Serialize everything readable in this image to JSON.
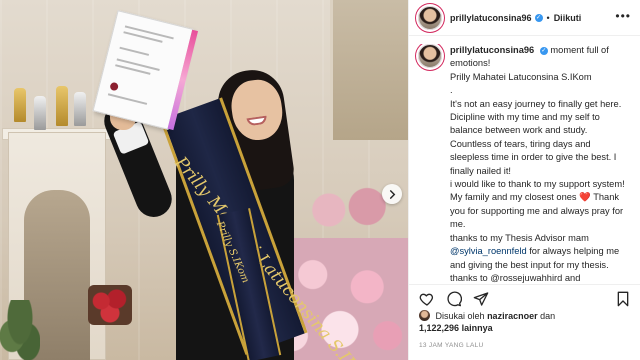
{
  "photo": {
    "sash_main_text": "Prilly Mahatei Latuconsina S.IKom",
    "sash_secondary_text": "Prilly S.IKom"
  },
  "post_header": {
    "username": "prillylatuconsina96",
    "verified": true,
    "separator": "•",
    "follow_status": "Diikuti",
    "more_icon": "more-horizontal-icon"
  },
  "caption": {
    "username": "prillylatuconsina96",
    "first_line": "moment full of emotions!",
    "lines": [
      "Prilly Mahatei Latuconsina S.IKom",
      ".",
      "It's not an easy journey to finally get here. Dicipline with my time and my self to balance between work and study. Countless of tears, tiring days and sleepless time in order to give the best. I finally nailed it!",
      "i would like to thank to my support system! My family and my closest ones",
      "Thank you for supporting me and always pray for me.",
      "thanks to my Thesis Advisor mam",
      "@sylvia_roennfeld",
      "for always helping me and giving the best input for my thesis.",
      "thanks to @rossejuwahhird and"
    ],
    "heart_emoji": "❤️"
  },
  "actions": {
    "like_icon": "heart-icon",
    "comment_icon": "comment-icon",
    "share_icon": "share-icon",
    "save_icon": "bookmark-icon"
  },
  "likes": {
    "prefix": "Disukai oleh",
    "liked_by": "naziracnoer",
    "conjunction": "dan",
    "count": "1,122,296",
    "suffix": "lainnya"
  },
  "timestamp": "13 JAM YANG LALU",
  "colors": {
    "verified_blue": "#3897f0",
    "mention_blue": "#00376b",
    "heart_red": "#ed4956",
    "story_ring": "#d32a5f",
    "sash_gold": "#c9a23a"
  }
}
